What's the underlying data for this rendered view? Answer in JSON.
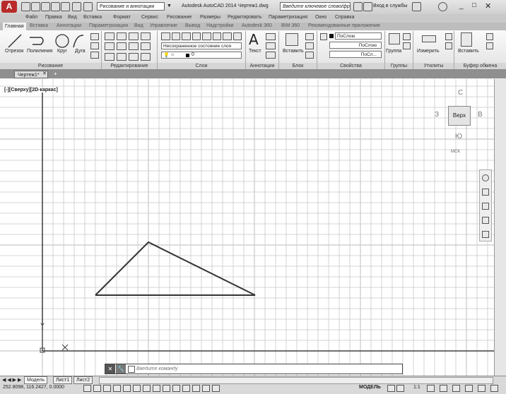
{
  "titlebar": {
    "workspace": "Рисование и аннотации",
    "app_title": "Autodesk AutoCAD 2014",
    "doc_name": "Чертеж1.dwg",
    "search_placeholder": "Введите ключевое слово/фразу",
    "login": "Вход в службы"
  },
  "menubar": {
    "items": [
      "Файл",
      "Правка",
      "Вид",
      "Вставка",
      "Формат",
      "Сервис",
      "Рисование",
      "Размеры",
      "Редактировать",
      "Параметризация",
      "Окно",
      "Справка"
    ]
  },
  "ribbon": {
    "tabs": [
      "Главная",
      "Вставка",
      "Аннотации",
      "Параметризация",
      "Вид",
      "Управление",
      "Вывод",
      "Надстройки",
      "Autodesk 360",
      "BIM 360",
      "Рекомендованные приложения"
    ],
    "draw_tools": [
      "Отрезок",
      "Полилиния",
      "Круг",
      "Дуга"
    ],
    "panels": [
      "Рисование",
      "Редактирование",
      "Слои",
      "Аннотации",
      "Блок",
      "Свойства",
      "Группы",
      "Утилиты",
      "Буфер обмена"
    ],
    "layer_state": "Несохраненное состояние слоя",
    "layer_name": "0",
    "text_label": "Текст",
    "insert_label": "Вставить",
    "prop_color": "ПоСлою",
    "prop_linetype": "ПоСлою",
    "prop_lineweight": "ПоСл...",
    "group_label": "Группа",
    "measure_label": "Измерить",
    "paste_label": "Вставить"
  },
  "doc_tab": "Чертеж1*",
  "viewport_label": "[-][Сверху][2D-каркас]",
  "viewcube": {
    "north": "С",
    "west": "З",
    "top": "Верх",
    "east": "В",
    "south": "Ю",
    "wcs": "МСК"
  },
  "ucs": {
    "y_label": "Y"
  },
  "command": {
    "placeholder": "Введите команду"
  },
  "layout_tabs": [
    "Модель",
    "Лист1",
    "Лист2"
  ],
  "status": {
    "coords": "252.8098, 116.2427, 0.0000",
    "model": "МОДЕЛЬ",
    "scale": "1:1"
  },
  "colors": {
    "ribbon_bg": "#e8e8e8",
    "grid": "#c8c8c8",
    "line": "#333333"
  }
}
